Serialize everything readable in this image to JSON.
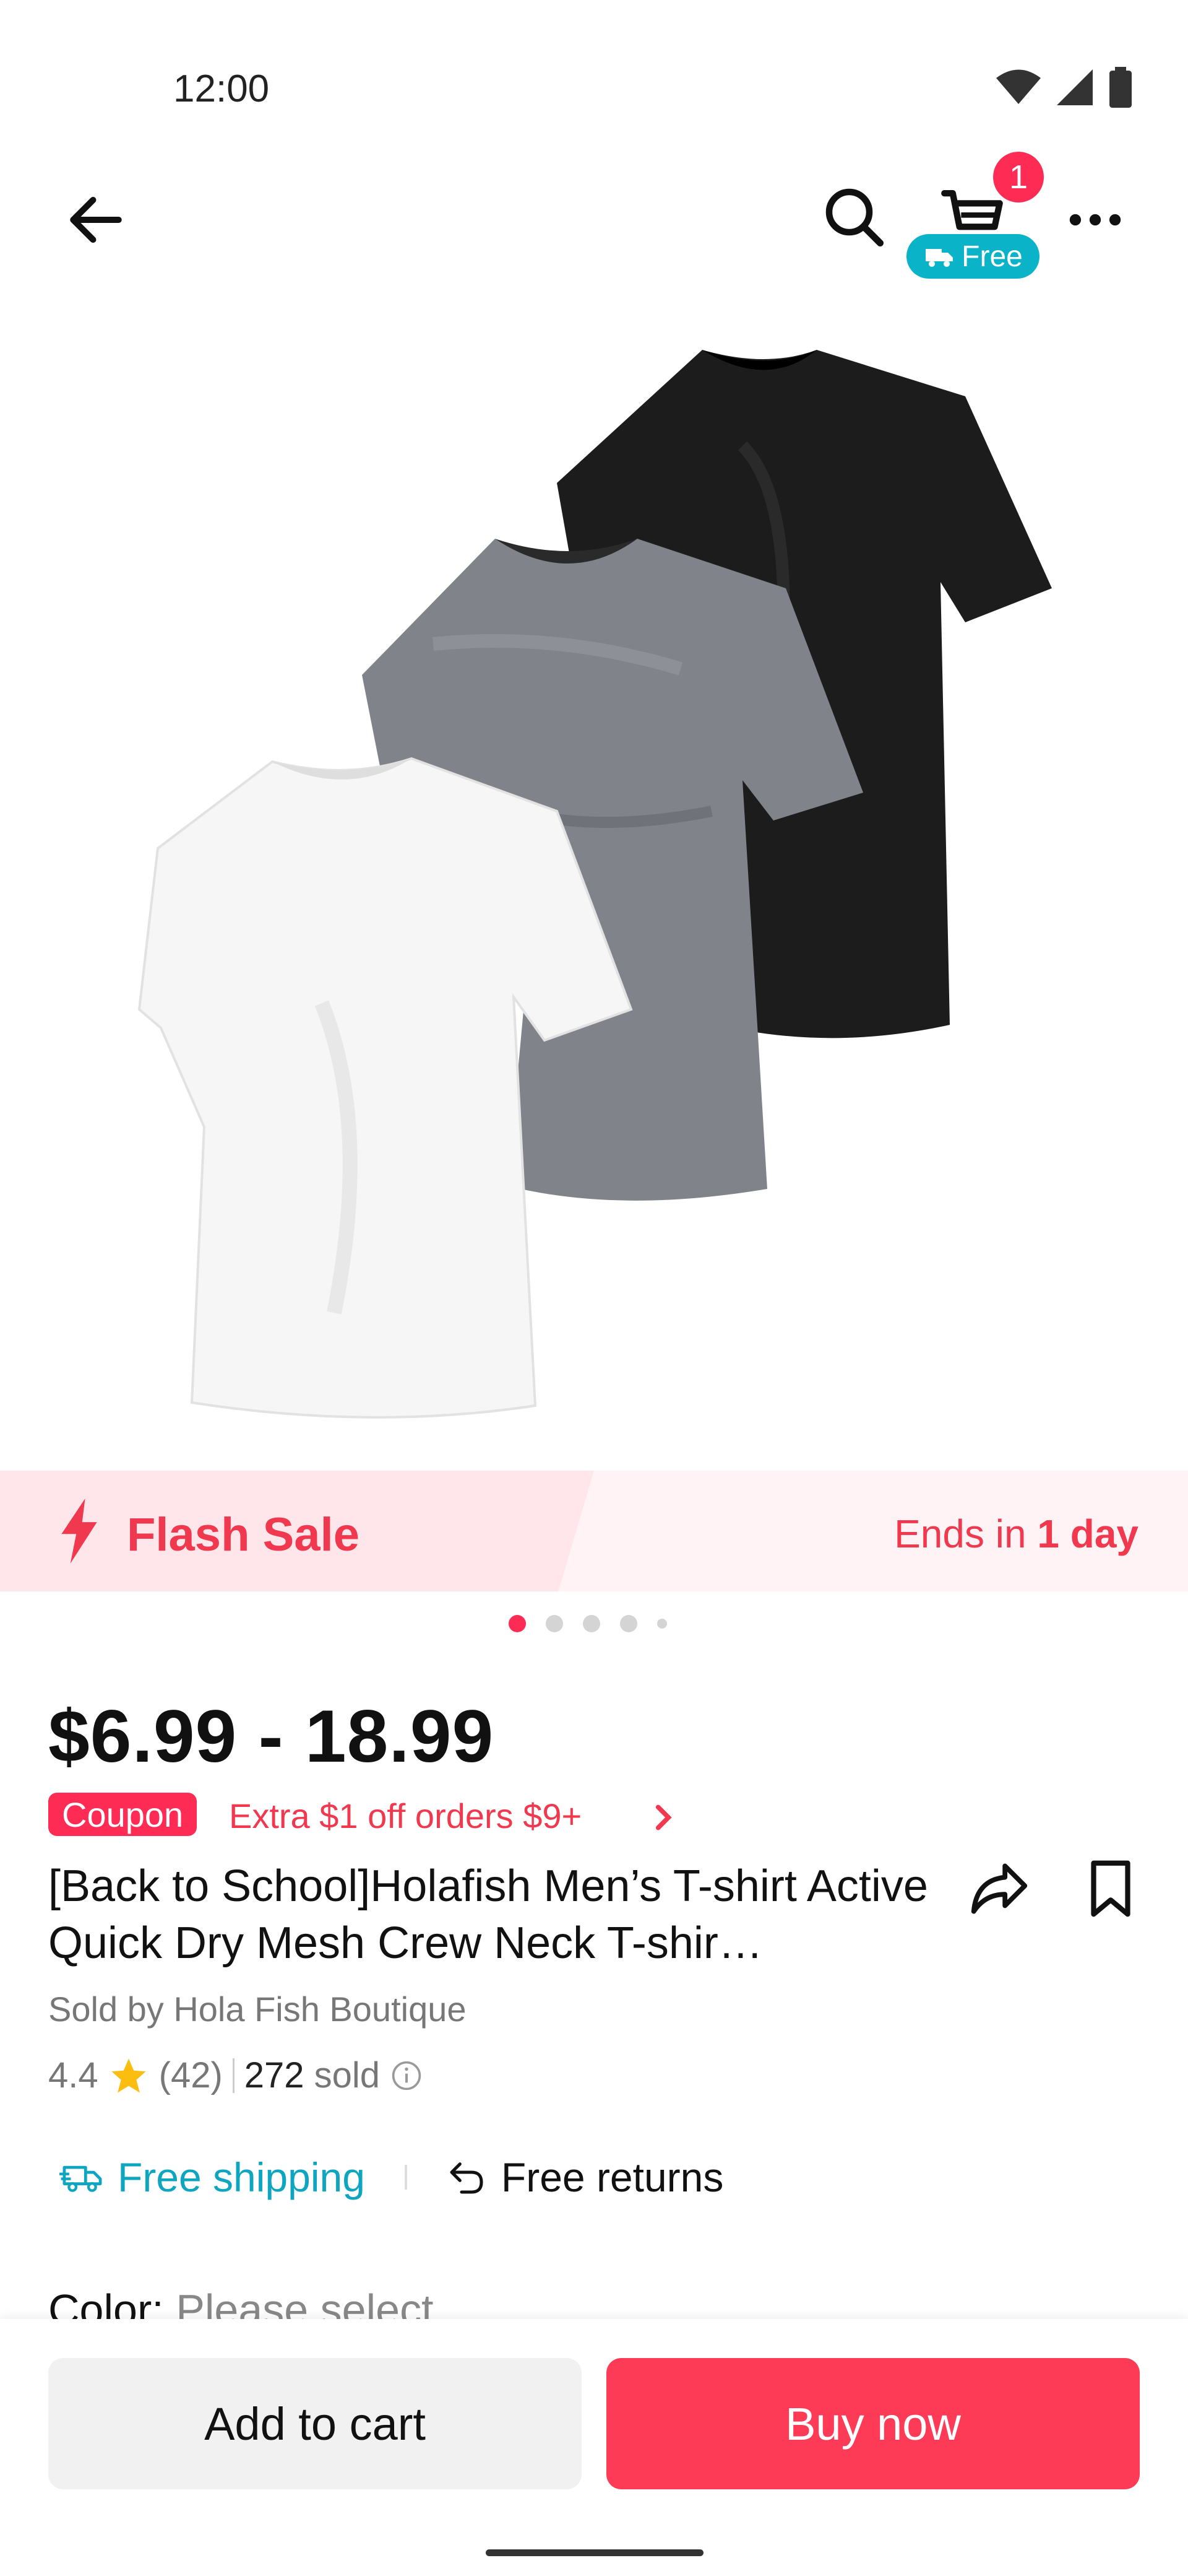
{
  "status_bar": {
    "time": "12:00",
    "icons": [
      "wifi-icon",
      "cellular-icon",
      "battery-icon"
    ]
  },
  "nav": {
    "cart_count": "1",
    "free_shipping_pill": "Free",
    "icons": [
      "back-arrow-icon",
      "search-icon",
      "cart-icon",
      "more-icon"
    ]
  },
  "hero": {
    "image_alt": "three t-shirts: white, grey, black",
    "carousel_total": 5,
    "carousel_active": 1
  },
  "flash_sale": {
    "label": "Flash Sale",
    "ends_prefix": "Ends in",
    "ends_value": "1 day"
  },
  "product": {
    "price": "$6.99 - 18.99",
    "coupon_tag": "Coupon",
    "coupon_text": "Extra $1 off orders $9+",
    "title": "[Back to School]Holafish Men’s T-shirt Active Quick Dry Mesh Crew Neck T-shir…",
    "seller": "Sold by Hola Fish Boutique",
    "rating": "4.4",
    "review_count": "(42)",
    "sold_count": "272",
    "sold_label": "sold",
    "shipping": "Free shipping",
    "returns": "Free returns",
    "color_label": "Color:",
    "color_value": "Please select"
  },
  "actions": {
    "add_to_cart": "Add to cart",
    "buy_now": "Buy now"
  },
  "colors": {
    "accent": "#fe2c55",
    "teal": "#0bb3c8",
    "flash_red": "#f0394f"
  }
}
